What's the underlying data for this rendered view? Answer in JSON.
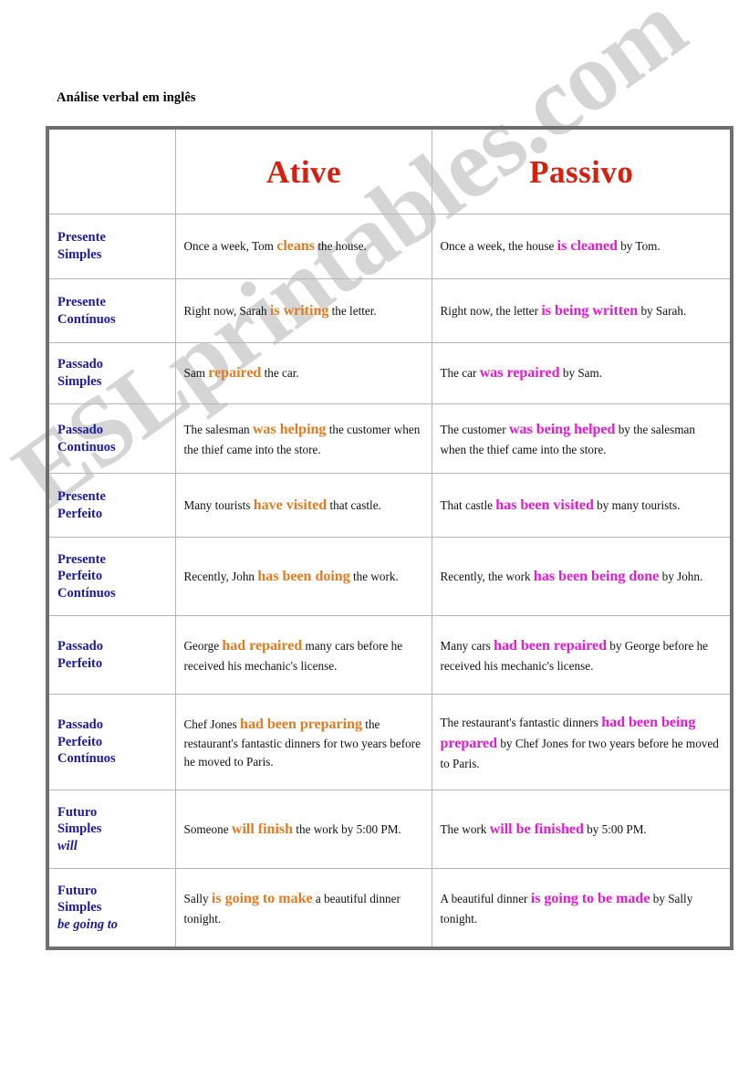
{
  "document": {
    "title": "Análise verbal em inglês",
    "watermark": "ESLprintables.com"
  },
  "colors": {
    "heading_red": "#d71f0f",
    "tense_blue": "#1a1a9c",
    "active_orange": "#e07c22",
    "passive_magenta": "#e01ecf",
    "border_outer": "#6e6e6e",
    "border_inner": "#b5b5b5",
    "watermark_gray": "#c8c8c8"
  },
  "table": {
    "columns": [
      "",
      "Ative",
      "Passivo"
    ],
    "rows": [
      {
        "tense": [
          "Presente",
          "Simples"
        ],
        "aux": "",
        "active": [
          {
            "t": "Once a week, Tom ",
            "hl": false
          },
          {
            "t": "cleans",
            "hl": true
          },
          {
            "t": " the house.",
            "hl": false
          }
        ],
        "passive": [
          {
            "t": "Once a week, the house ",
            "hl": false
          },
          {
            "t": "is cleaned",
            "hl": true
          },
          {
            "t": " by Tom.",
            "hl": false
          }
        ]
      },
      {
        "tense": [
          "Presente",
          "Contínuos"
        ],
        "aux": "",
        "active": [
          {
            "t": "Right now, Sarah ",
            "hl": false
          },
          {
            "t": "is writing",
            "hl": true
          },
          {
            "t": " the letter.",
            "hl": false
          }
        ],
        "passive": [
          {
            "t": "Right now, the letter ",
            "hl": false
          },
          {
            "t": "is being written",
            "hl": true
          },
          {
            "t": " by Sarah.",
            "hl": false
          }
        ]
      },
      {
        "tense": [
          "Passado",
          "Simples"
        ],
        "aux": "",
        "active": [
          {
            "t": "Sam ",
            "hl": false
          },
          {
            "t": "repaired",
            "hl": true
          },
          {
            "t": " the car.",
            "hl": false
          }
        ],
        "passive": [
          {
            "t": "The car ",
            "hl": false
          },
          {
            "t": "was repaired",
            "hl": true
          },
          {
            "t": " by Sam.",
            "hl": false
          }
        ]
      },
      {
        "tense": [
          "Passado",
          "Continuos"
        ],
        "aux": "",
        "active": [
          {
            "t": "The salesman ",
            "hl": false
          },
          {
            "t": "was helping",
            "hl": true
          },
          {
            "t": " the customer when the thief came into the store.",
            "hl": false
          }
        ],
        "passive": [
          {
            "t": "The customer ",
            "hl": false
          },
          {
            "t": "was being helped",
            "hl": true
          },
          {
            "t": " by the salesman when the thief came into the store.",
            "hl": false
          }
        ]
      },
      {
        "tense": [
          "Presente",
          "Perfeito"
        ],
        "aux": "",
        "active": [
          {
            "t": "Many tourists ",
            "hl": false
          },
          {
            "t": "have visited",
            "hl": true
          },
          {
            "t": " that castle.",
            "hl": false
          }
        ],
        "passive": [
          {
            "t": "That castle ",
            "hl": false
          },
          {
            "t": "has been visited",
            "hl": true
          },
          {
            "t": " by many tourists.",
            "hl": false
          }
        ]
      },
      {
        "tense": [
          "Presente",
          "Perfeito",
          "Contínuos"
        ],
        "aux": "",
        "active": [
          {
            "t": "Recently, John ",
            "hl": false
          },
          {
            "t": "has been doing",
            "hl": true
          },
          {
            "t": " the work.",
            "hl": false
          }
        ],
        "passive": [
          {
            "t": "Recently, the work ",
            "hl": false
          },
          {
            "t": "has been being done",
            "hl": true
          },
          {
            "t": " by John.",
            "hl": false
          }
        ]
      },
      {
        "tense": [
          "Passado",
          "Perfeito"
        ],
        "aux": "",
        "active": [
          {
            "t": "George ",
            "hl": false
          },
          {
            "t": "had repaired",
            "hl": true
          },
          {
            "t": " many cars before he received his mechanic's license.",
            "hl": false
          }
        ],
        "passive": [
          {
            "t": "Many cars ",
            "hl": false
          },
          {
            "t": "had been repaired",
            "hl": true
          },
          {
            "t": " by George before he received his mechanic's license.",
            "hl": false
          }
        ]
      },
      {
        "tense": [
          "Passado",
          "Perfeito",
          "Contínuos"
        ],
        "aux": "",
        "active": [
          {
            "t": "Chef Jones ",
            "hl": false
          },
          {
            "t": "had been preparing",
            "hl": true
          },
          {
            "t": " the restaurant's fantastic dinners for two years before he moved to Paris.",
            "hl": false
          }
        ],
        "passive": [
          {
            "t": "The restaurant's fantastic dinners ",
            "hl": false
          },
          {
            "t": "had been being prepared",
            "hl": true
          },
          {
            "t": " by Chef Jones for two years before he moved to Paris.",
            "hl": false
          }
        ]
      },
      {
        "tense": [
          "Futuro",
          "Simples"
        ],
        "aux": "will",
        "active": [
          {
            "t": "Someone ",
            "hl": false
          },
          {
            "t": "will finish",
            "hl": true
          },
          {
            "t": " the work by 5:00 PM.",
            "hl": false
          }
        ],
        "passive": [
          {
            "t": "The work ",
            "hl": false
          },
          {
            "t": "will be finished",
            "hl": true
          },
          {
            "t": " by 5:00 PM.",
            "hl": false
          }
        ]
      },
      {
        "tense": [
          "Futuro",
          "Simples"
        ],
        "aux": "be going to",
        "active": [
          {
            "t": "Sally ",
            "hl": false
          },
          {
            "t": "is going to make",
            "hl": true
          },
          {
            "t": " a beautiful dinner tonight.",
            "hl": false
          }
        ],
        "passive": [
          {
            "t": "A beautiful dinner ",
            "hl": false
          },
          {
            "t": "is going to be made",
            "hl": true
          },
          {
            "t": " by Sally tonight.",
            "hl": false
          }
        ]
      }
    ]
  }
}
